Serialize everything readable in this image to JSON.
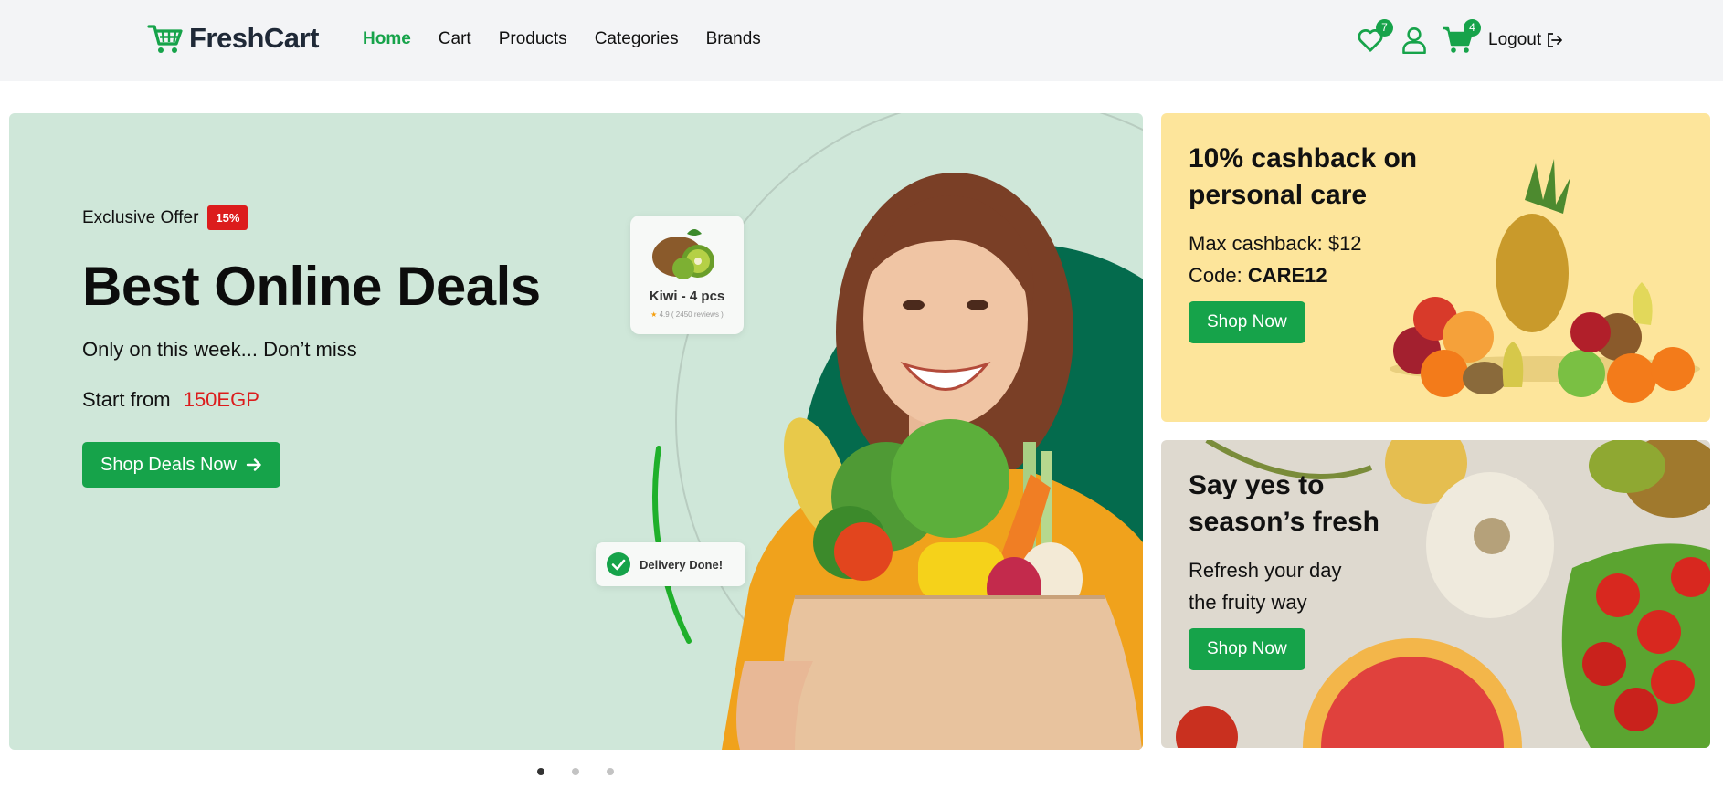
{
  "navbar": {
    "brand": "FreshCart",
    "links": [
      "Home",
      "Cart",
      "Products",
      "Categories",
      "Brands"
    ],
    "wishlist_count": "7",
    "cart_count": "4",
    "logout": "Logout"
  },
  "hero": {
    "offer_label": "Exclusive Offer",
    "offer_badge": "15%",
    "title": "Best Online Deals",
    "subtitle": "Only on this week... Don’t miss",
    "price_prefix": "Start from",
    "price_amount": "150EGP",
    "cta": "Shop Deals Now",
    "kiwi_card": {
      "name": "Kiwi - 4 pcs",
      "rating": "4.9",
      "reviews": "( 2450 reviews )"
    },
    "delivery_text": "Delivery Done!"
  },
  "promo_top": {
    "title_line1": "10% cashback on",
    "title_line2": "personal care",
    "cashback": "Max cashback: $12",
    "code_label": "Code:",
    "code_value": "CARE12",
    "cta": "Shop Now"
  },
  "promo_bottom": {
    "title_line1": "Say yes to",
    "title_line2": "season’s fresh",
    "line1": "Refresh your day",
    "line2": "the fruity way",
    "cta": "Shop Now"
  },
  "carousel": {
    "active_index": 0,
    "count": 3
  },
  "colors": {
    "brand_green": "#16a34a",
    "offer_red": "#dc1c1c",
    "hero_bg": "#cfe7d9",
    "promo_yellow": "#fde59b"
  }
}
